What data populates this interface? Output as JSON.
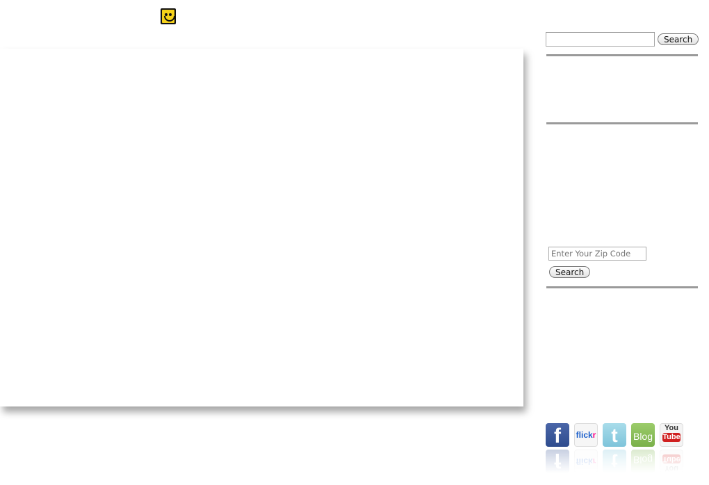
{
  "header": {
    "logo_icon": "smiley-face-icon"
  },
  "sidebar": {
    "site_search": {
      "value": "",
      "placeholder": "",
      "button_label": "Search"
    },
    "zip_search": {
      "placeholder": "Enter Your Zip Code",
      "button_label": "Search"
    },
    "social": [
      {
        "name": "facebook",
        "label": "f"
      },
      {
        "name": "flickr",
        "label": "flick",
        "label_accent": "r"
      },
      {
        "name": "twitter",
        "label": "t"
      },
      {
        "name": "blog",
        "label": "Blog"
      },
      {
        "name": "youtube",
        "label": "You",
        "label_accent": "Tube"
      }
    ]
  },
  "colors": {
    "divider": "#9a9a9a",
    "zip_placeholder": "#4a6aa0",
    "smiley": "#f6d21a"
  }
}
